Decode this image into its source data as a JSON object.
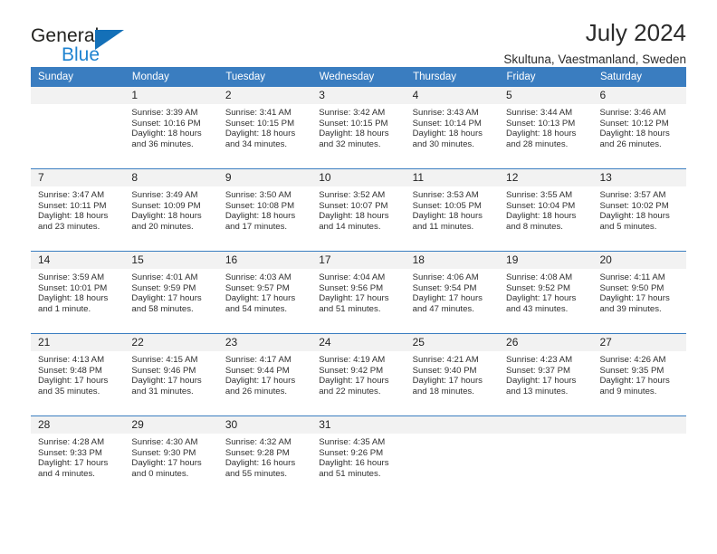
{
  "brand": {
    "line1": "General",
    "line2": "Blue",
    "triangle_color": "#1470b8",
    "blue_color": "#1f83d0"
  },
  "header": {
    "title": "July 2024",
    "subtitle": "Skultuna, Vaestmanland, Sweden"
  },
  "theme": {
    "header_bg": "#3a7dc0",
    "daynum_bg": "#f2f2f2",
    "row_divider": "#3a7dc0"
  },
  "weekdays": [
    "Sunday",
    "Monday",
    "Tuesday",
    "Wednesday",
    "Thursday",
    "Friday",
    "Saturday"
  ],
  "weeks": [
    [
      {
        "day": "",
        "sunrise": "",
        "sunset": "",
        "daylight1": "",
        "daylight2": ""
      },
      {
        "day": "1",
        "sunrise": "Sunrise: 3:39 AM",
        "sunset": "Sunset: 10:16 PM",
        "daylight1": "Daylight: 18 hours",
        "daylight2": "and 36 minutes."
      },
      {
        "day": "2",
        "sunrise": "Sunrise: 3:41 AM",
        "sunset": "Sunset: 10:15 PM",
        "daylight1": "Daylight: 18 hours",
        "daylight2": "and 34 minutes."
      },
      {
        "day": "3",
        "sunrise": "Sunrise: 3:42 AM",
        "sunset": "Sunset: 10:15 PM",
        "daylight1": "Daylight: 18 hours",
        "daylight2": "and 32 minutes."
      },
      {
        "day": "4",
        "sunrise": "Sunrise: 3:43 AM",
        "sunset": "Sunset: 10:14 PM",
        "daylight1": "Daylight: 18 hours",
        "daylight2": "and 30 minutes."
      },
      {
        "day": "5",
        "sunrise": "Sunrise: 3:44 AM",
        "sunset": "Sunset: 10:13 PM",
        "daylight1": "Daylight: 18 hours",
        "daylight2": "and 28 minutes."
      },
      {
        "day": "6",
        "sunrise": "Sunrise: 3:46 AM",
        "sunset": "Sunset: 10:12 PM",
        "daylight1": "Daylight: 18 hours",
        "daylight2": "and 26 minutes."
      }
    ],
    [
      {
        "day": "7",
        "sunrise": "Sunrise: 3:47 AM",
        "sunset": "Sunset: 10:11 PM",
        "daylight1": "Daylight: 18 hours",
        "daylight2": "and 23 minutes."
      },
      {
        "day": "8",
        "sunrise": "Sunrise: 3:49 AM",
        "sunset": "Sunset: 10:09 PM",
        "daylight1": "Daylight: 18 hours",
        "daylight2": "and 20 minutes."
      },
      {
        "day": "9",
        "sunrise": "Sunrise: 3:50 AM",
        "sunset": "Sunset: 10:08 PM",
        "daylight1": "Daylight: 18 hours",
        "daylight2": "and 17 minutes."
      },
      {
        "day": "10",
        "sunrise": "Sunrise: 3:52 AM",
        "sunset": "Sunset: 10:07 PM",
        "daylight1": "Daylight: 18 hours",
        "daylight2": "and 14 minutes."
      },
      {
        "day": "11",
        "sunrise": "Sunrise: 3:53 AM",
        "sunset": "Sunset: 10:05 PM",
        "daylight1": "Daylight: 18 hours",
        "daylight2": "and 11 minutes."
      },
      {
        "day": "12",
        "sunrise": "Sunrise: 3:55 AM",
        "sunset": "Sunset: 10:04 PM",
        "daylight1": "Daylight: 18 hours",
        "daylight2": "and 8 minutes."
      },
      {
        "day": "13",
        "sunrise": "Sunrise: 3:57 AM",
        "sunset": "Sunset: 10:02 PM",
        "daylight1": "Daylight: 18 hours",
        "daylight2": "and 5 minutes."
      }
    ],
    [
      {
        "day": "14",
        "sunrise": "Sunrise: 3:59 AM",
        "sunset": "Sunset: 10:01 PM",
        "daylight1": "Daylight: 18 hours",
        "daylight2": "and 1 minute."
      },
      {
        "day": "15",
        "sunrise": "Sunrise: 4:01 AM",
        "sunset": "Sunset: 9:59 PM",
        "daylight1": "Daylight: 17 hours",
        "daylight2": "and 58 minutes."
      },
      {
        "day": "16",
        "sunrise": "Sunrise: 4:03 AM",
        "sunset": "Sunset: 9:57 PM",
        "daylight1": "Daylight: 17 hours",
        "daylight2": "and 54 minutes."
      },
      {
        "day": "17",
        "sunrise": "Sunrise: 4:04 AM",
        "sunset": "Sunset: 9:56 PM",
        "daylight1": "Daylight: 17 hours",
        "daylight2": "and 51 minutes."
      },
      {
        "day": "18",
        "sunrise": "Sunrise: 4:06 AM",
        "sunset": "Sunset: 9:54 PM",
        "daylight1": "Daylight: 17 hours",
        "daylight2": "and 47 minutes."
      },
      {
        "day": "19",
        "sunrise": "Sunrise: 4:08 AM",
        "sunset": "Sunset: 9:52 PM",
        "daylight1": "Daylight: 17 hours",
        "daylight2": "and 43 minutes."
      },
      {
        "day": "20",
        "sunrise": "Sunrise: 4:11 AM",
        "sunset": "Sunset: 9:50 PM",
        "daylight1": "Daylight: 17 hours",
        "daylight2": "and 39 minutes."
      }
    ],
    [
      {
        "day": "21",
        "sunrise": "Sunrise: 4:13 AM",
        "sunset": "Sunset: 9:48 PM",
        "daylight1": "Daylight: 17 hours",
        "daylight2": "and 35 minutes."
      },
      {
        "day": "22",
        "sunrise": "Sunrise: 4:15 AM",
        "sunset": "Sunset: 9:46 PM",
        "daylight1": "Daylight: 17 hours",
        "daylight2": "and 31 minutes."
      },
      {
        "day": "23",
        "sunrise": "Sunrise: 4:17 AM",
        "sunset": "Sunset: 9:44 PM",
        "daylight1": "Daylight: 17 hours",
        "daylight2": "and 26 minutes."
      },
      {
        "day": "24",
        "sunrise": "Sunrise: 4:19 AM",
        "sunset": "Sunset: 9:42 PM",
        "daylight1": "Daylight: 17 hours",
        "daylight2": "and 22 minutes."
      },
      {
        "day": "25",
        "sunrise": "Sunrise: 4:21 AM",
        "sunset": "Sunset: 9:40 PM",
        "daylight1": "Daylight: 17 hours",
        "daylight2": "and 18 minutes."
      },
      {
        "day": "26",
        "sunrise": "Sunrise: 4:23 AM",
        "sunset": "Sunset: 9:37 PM",
        "daylight1": "Daylight: 17 hours",
        "daylight2": "and 13 minutes."
      },
      {
        "day": "27",
        "sunrise": "Sunrise: 4:26 AM",
        "sunset": "Sunset: 9:35 PM",
        "daylight1": "Daylight: 17 hours",
        "daylight2": "and 9 minutes."
      }
    ],
    [
      {
        "day": "28",
        "sunrise": "Sunrise: 4:28 AM",
        "sunset": "Sunset: 9:33 PM",
        "daylight1": "Daylight: 17 hours",
        "daylight2": "and 4 minutes."
      },
      {
        "day": "29",
        "sunrise": "Sunrise: 4:30 AM",
        "sunset": "Sunset: 9:30 PM",
        "daylight1": "Daylight: 17 hours",
        "daylight2": "and 0 minutes."
      },
      {
        "day": "30",
        "sunrise": "Sunrise: 4:32 AM",
        "sunset": "Sunset: 9:28 PM",
        "daylight1": "Daylight: 16 hours",
        "daylight2": "and 55 minutes."
      },
      {
        "day": "31",
        "sunrise": "Sunrise: 4:35 AM",
        "sunset": "Sunset: 9:26 PM",
        "daylight1": "Daylight: 16 hours",
        "daylight2": "and 51 minutes."
      },
      {
        "day": "",
        "sunrise": "",
        "sunset": "",
        "daylight1": "",
        "daylight2": ""
      },
      {
        "day": "",
        "sunrise": "",
        "sunset": "",
        "daylight1": "",
        "daylight2": ""
      },
      {
        "day": "",
        "sunrise": "",
        "sunset": "",
        "daylight1": "",
        "daylight2": ""
      }
    ]
  ]
}
